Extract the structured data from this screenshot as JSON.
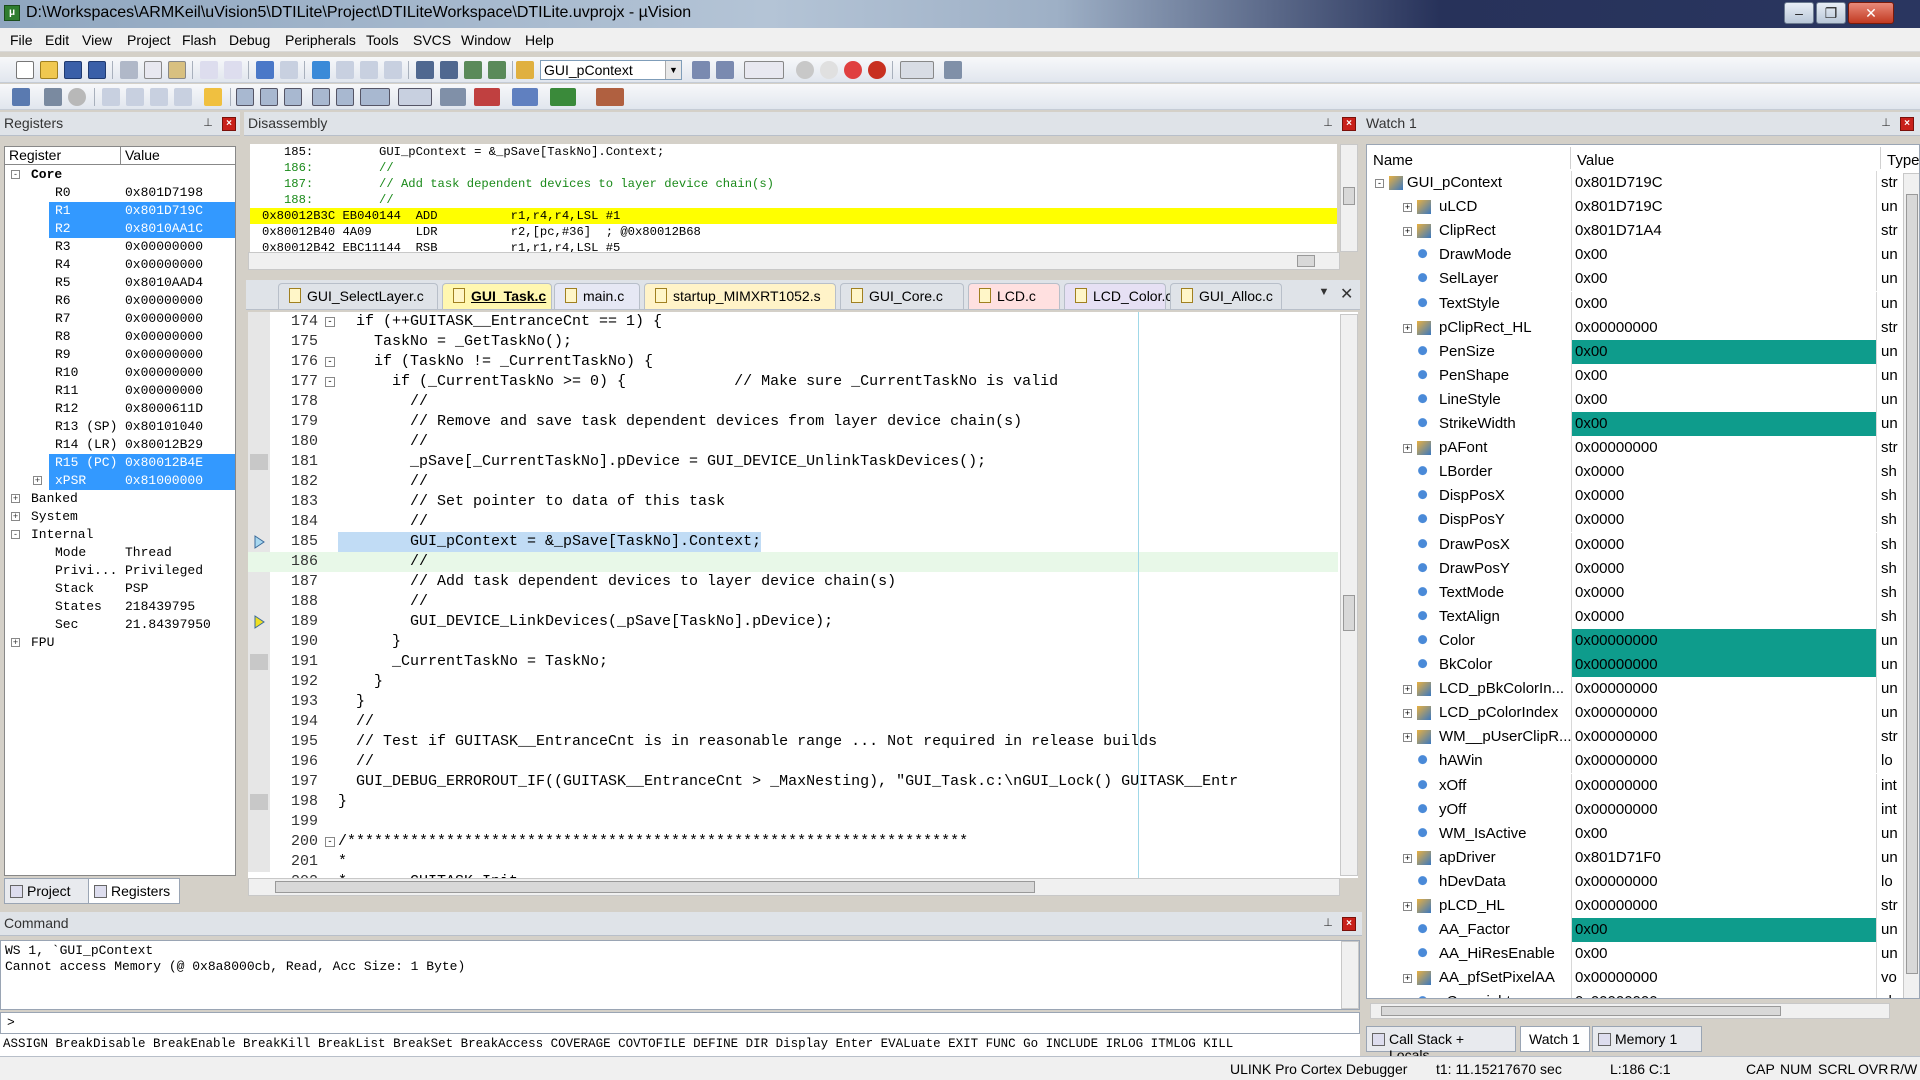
{
  "window": {
    "title": "D:\\Workspaces\\ARMKeil\\uVision5\\DTILite\\Project\\DTILiteWorkspace\\DTILite.uvprojx - µVision"
  },
  "menu": [
    "File",
    "Edit",
    "View",
    "Project",
    "Flash",
    "Debug",
    "Peripherals",
    "Tools",
    "SVCS",
    "Window",
    "Help"
  ],
  "toolbar": {
    "combo_value": "GUI_pContext"
  },
  "registers": {
    "title": "Registers",
    "col_register": "Register",
    "col_value": "Value",
    "rows": [
      {
        "name": "Core",
        "value": "",
        "bold": true
      },
      {
        "name": "R0",
        "value": "0x801D7198"
      },
      {
        "name": "R1",
        "value": "0x801D719C",
        "sel": true
      },
      {
        "name": "R2",
        "value": "0x8010AA1C",
        "sel": true
      },
      {
        "name": "R3",
        "value": "0x00000000"
      },
      {
        "name": "R4",
        "value": "0x00000000"
      },
      {
        "name": "R5",
        "value": "0x8010AAD4"
      },
      {
        "name": "R6",
        "value": "0x00000000"
      },
      {
        "name": "R7",
        "value": "0x00000000"
      },
      {
        "name": "R8",
        "value": "0x00000000"
      },
      {
        "name": "R9",
        "value": "0x00000000"
      },
      {
        "name": "R10",
        "value": "0x00000000"
      },
      {
        "name": "R11",
        "value": "0x00000000"
      },
      {
        "name": "R12",
        "value": "0x8000611D"
      },
      {
        "name": "R13 (SP)",
        "value": "0x80101040"
      },
      {
        "name": "R14 (LR)",
        "value": "0x80012B29"
      },
      {
        "name": "R15 (PC)",
        "value": "0x80012B4E",
        "sel": true
      },
      {
        "name": "xPSR",
        "value": "0x81000000",
        "sel": true
      },
      {
        "name": "Banked",
        "value": ""
      },
      {
        "name": "System",
        "value": ""
      },
      {
        "name": "Internal",
        "value": ""
      },
      {
        "name": "Mode",
        "value": "Thread"
      },
      {
        "name": "Privi...",
        "value": "Privileged"
      },
      {
        "name": "Stack",
        "value": "PSP"
      },
      {
        "name": "States",
        "value": "218439795"
      },
      {
        "name": "Sec",
        "value": "21.84397950"
      },
      {
        "name": "FPU",
        "value": ""
      }
    ],
    "tab_project": "Project",
    "tab_registers": "Registers"
  },
  "disassembly": {
    "title": "Disassembly",
    "lines": [
      "   185:         GUI_pContext = &_pSave[TaskNo].Context;",
      "   186:         //",
      "   187:         // Add task dependent devices to layer device chain(s)",
      "   188:         //",
      "0x80012B3C EB040144  ADD          r1,r4,r4,LSL #1",
      "0x80012B40 4A09      LDR          r2,[pc,#36]  ; @0x80012B68",
      "0x80012B42 EBC11144  RSB          r1,r1,r4,LSL #5"
    ]
  },
  "editor": {
    "tabs": [
      "GUI_SelectLayer.c",
      "GUI_Task.c",
      "main.c",
      "startup_MIMXRT1052.s",
      "GUI_Core.c",
      "LCD.c",
      "LCD_Color.c",
      "GUI_Alloc.c"
    ],
    "lines": [
      {
        "n": "174",
        "t": "  if (++GUITASK__EntranceCnt == 1) {"
      },
      {
        "n": "175",
        "t": "    TaskNo = _GetTaskNo();"
      },
      {
        "n": "176",
        "t": "    if (TaskNo != _CurrentTaskNo) {"
      },
      {
        "n": "177",
        "t": "      if (_CurrentTaskNo >= 0) {            // Make sure _CurrentTaskNo is valid"
      },
      {
        "n": "178",
        "t": "        //"
      },
      {
        "n": "179",
        "t": "        // Remove and save task dependent devices from layer device chain(s)"
      },
      {
        "n": "180",
        "t": "        //"
      },
      {
        "n": "181",
        "t": "        _pSave[_CurrentTaskNo].pDevice = GUI_DEVICE_UnlinkTaskDevices();"
      },
      {
        "n": "182",
        "t": "        //"
      },
      {
        "n": "183",
        "t": "        // Set pointer to data of this task"
      },
      {
        "n": "184",
        "t": "        //"
      },
      {
        "n": "185",
        "t": "        GUI_pContext = &_pSave[TaskNo].Context;"
      },
      {
        "n": "186",
        "t": "        //"
      },
      {
        "n": "187",
        "t": "        // Add task dependent devices to layer device chain(s)"
      },
      {
        "n": "188",
        "t": "        //"
      },
      {
        "n": "189",
        "t": "        GUI_DEVICE_LinkDevices(_pSave[TaskNo].pDevice);"
      },
      {
        "n": "190",
        "t": "      }"
      },
      {
        "n": "191",
        "t": "      _CurrentTaskNo = TaskNo;"
      },
      {
        "n": "192",
        "t": "    }"
      },
      {
        "n": "193",
        "t": "  }"
      },
      {
        "n": "194",
        "t": "  //"
      },
      {
        "n": "195",
        "t": "  // Test if GUITASK__EntranceCnt is in reasonable range ... Not required in release builds"
      },
      {
        "n": "196",
        "t": "  //"
      },
      {
        "n": "197",
        "t": "  GUI_DEBUG_ERROROUT_IF((GUITASK__EntranceCnt > _MaxNesting), \"GUI_Task.c:\\nGUI_Lock() GUITASK__Entr"
      },
      {
        "n": "198",
        "t": "}"
      },
      {
        "n": "199",
        "t": ""
      },
      {
        "n": "200",
        "t": "/*********************************************************************"
      },
      {
        "n": "201",
        "t": "*"
      },
      {
        "n": "202",
        "t": "*       GUITASK_Init"
      }
    ]
  },
  "watch": {
    "title": "Watch 1",
    "col_name": "Name",
    "col_value": "Value",
    "col_type": "Type",
    "rows": [
      {
        "name": "GUI_pContext",
        "value": "0x801D719C",
        "type": "str",
        "lvl": 0,
        "exp": "-"
      },
      {
        "name": "uLCD",
        "value": "0x801D719C",
        "type": "un",
        "lvl": 1,
        "exp": "+"
      },
      {
        "name": "ClipRect",
        "value": "0x801D71A4",
        "type": "str",
        "lvl": 1,
        "exp": "+"
      },
      {
        "name": "DrawMode",
        "value": "0x00",
        "type": "un",
        "lvl": 1
      },
      {
        "name": "SelLayer",
        "value": "0x00",
        "type": "un",
        "lvl": 1
      },
      {
        "name": "TextStyle",
        "value": "0x00",
        "type": "un",
        "lvl": 1
      },
      {
        "name": "pClipRect_HL",
        "value": "0x00000000",
        "type": "str",
        "lvl": 1,
        "exp": "+"
      },
      {
        "name": "PenSize",
        "value": "0x00",
        "type": "un",
        "lvl": 1,
        "hl": true
      },
      {
        "name": "PenShape",
        "value": "0x00",
        "type": "un",
        "lvl": 1
      },
      {
        "name": "LineStyle",
        "value": "0x00",
        "type": "un",
        "lvl": 1
      },
      {
        "name": "StrikeWidth",
        "value": "0x00",
        "type": "un",
        "lvl": 1,
        "hl": true
      },
      {
        "name": "pAFont",
        "value": "0x00000000",
        "type": "str",
        "lvl": 1,
        "exp": "+"
      },
      {
        "name": "LBorder",
        "value": "0x0000",
        "type": "sh",
        "lvl": 1
      },
      {
        "name": "DispPosX",
        "value": "0x0000",
        "type": "sh",
        "lvl": 1
      },
      {
        "name": "DispPosY",
        "value": "0x0000",
        "type": "sh",
        "lvl": 1
      },
      {
        "name": "DrawPosX",
        "value": "0x0000",
        "type": "sh",
        "lvl": 1
      },
      {
        "name": "DrawPosY",
        "value": "0x0000",
        "type": "sh",
        "lvl": 1
      },
      {
        "name": "TextMode",
        "value": "0x0000",
        "type": "sh",
        "lvl": 1
      },
      {
        "name": "TextAlign",
        "value": "0x0000",
        "type": "sh",
        "lvl": 1
      },
      {
        "name": "Color",
        "value": "0x00000000",
        "type": "un",
        "lvl": 1,
        "hl": true
      },
      {
        "name": "BkColor",
        "value": "0x00000000",
        "type": "un",
        "lvl": 1,
        "hl": true
      },
      {
        "name": "LCD_pBkColorIn...",
        "value": "0x00000000",
        "type": "un",
        "lvl": 1,
        "exp": "+"
      },
      {
        "name": "LCD_pColorIndex",
        "value": "0x00000000",
        "type": "un",
        "lvl": 1,
        "exp": "+"
      },
      {
        "name": "WM__pUserClipR...",
        "value": "0x00000000",
        "type": "str",
        "lvl": 1,
        "exp": "+"
      },
      {
        "name": "hAWin",
        "value": "0x00000000",
        "type": "lo",
        "lvl": 1
      },
      {
        "name": "xOff",
        "value": "0x00000000",
        "type": "int",
        "lvl": 1
      },
      {
        "name": "yOff",
        "value": "0x00000000",
        "type": "int",
        "lvl": 1
      },
      {
        "name": "WM_IsActive",
        "value": "0x00",
        "type": "un",
        "lvl": 1
      },
      {
        "name": "apDriver",
        "value": "0x801D71F0",
        "type": "un",
        "lvl": 1,
        "exp": "+"
      },
      {
        "name": "hDevData",
        "value": "0x00000000",
        "type": "lo",
        "lvl": 1
      },
      {
        "name": "pLCD_HL",
        "value": "0x00000000",
        "type": "str",
        "lvl": 1,
        "exp": "+"
      },
      {
        "name": "AA_Factor",
        "value": "0x00",
        "type": "un",
        "lvl": 1,
        "hl": true
      },
      {
        "name": "AA_HiResEnable",
        "value": "0x00",
        "type": "un",
        "lvl": 1
      },
      {
        "name": "AA_pfSetPixelAA",
        "value": "0x00000000",
        "type": "vo",
        "lvl": 1,
        "exp": "+"
      },
      {
        "name": "sCopyright",
        "value": "0x00000000",
        "type": "ch",
        "lvl": 1
      }
    ],
    "tabs": [
      "Call Stack + Locals",
      "Watch 1",
      "Memory 1"
    ]
  },
  "command": {
    "title": "Command",
    "output": [
      "WS 1, `GUI_pContext",
      "Cannot access Memory (@ 0x8a8000cb, Read, Acc Size: 1 Byte)"
    ],
    "prompt": ">",
    "help": "ASSIGN BreakDisable BreakEnable BreakKill BreakList BreakSet BreakAccess COVERAGE COVTOFILE DEFINE DIR Display Enter EVALuate EXIT FUNC Go INCLUDE IRLOG ITMLOG KILL"
  },
  "status": {
    "debugger": "ULINK Pro Cortex Debugger",
    "time": "t1: 11.15217670 sec",
    "pos": "L:186 C:1",
    "caps": "CAP",
    "num": "NUM",
    "scrl": "SCRL",
    "ovr": "OVR",
    "rw": "R/W"
  },
  "colors": {
    "highlight_teal": "#0e9c8c",
    "selection_blue": "#3399ff",
    "current_line_yellow": "#ffff00",
    "editor_select": "#c1dcf5"
  }
}
